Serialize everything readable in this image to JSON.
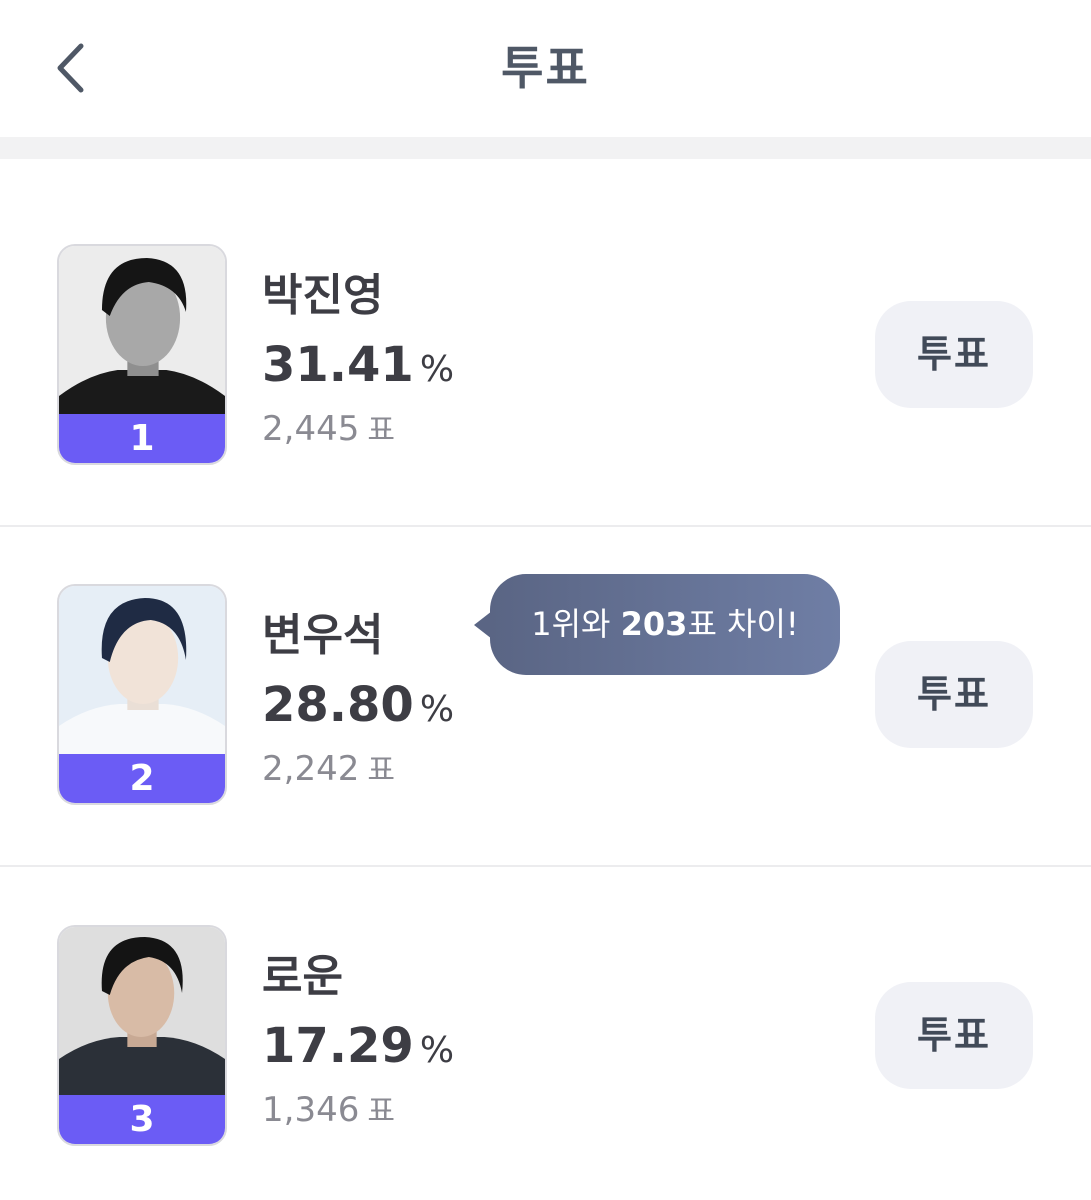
{
  "header": {
    "title": "투표",
    "back_icon": "chevron-left-icon"
  },
  "colors": {
    "rank_band": "#6b5cf5",
    "vote_button_bg": "#f0f1f6",
    "tooltip_bg": "#5f6b8d",
    "title_text": "#4f5866"
  },
  "candidates": [
    {
      "rank": "1",
      "name": "박진영",
      "percent": "31.41",
      "percent_unit": "%",
      "votes": "2,445",
      "votes_unit": "표",
      "vote_button_label": "투표"
    },
    {
      "rank": "2",
      "name": "변우석",
      "percent": "28.80",
      "percent_unit": "%",
      "votes": "2,242",
      "votes_unit": "표",
      "vote_button_label": "투표"
    },
    {
      "rank": "3",
      "name": "로운",
      "percent": "17.29",
      "percent_unit": "%",
      "votes": "1,346",
      "votes_unit": "표",
      "vote_button_label": "투표"
    }
  ],
  "tooltip": {
    "prefix": "1위와 ",
    "gap": "203",
    "suffix": "표 차이!"
  }
}
